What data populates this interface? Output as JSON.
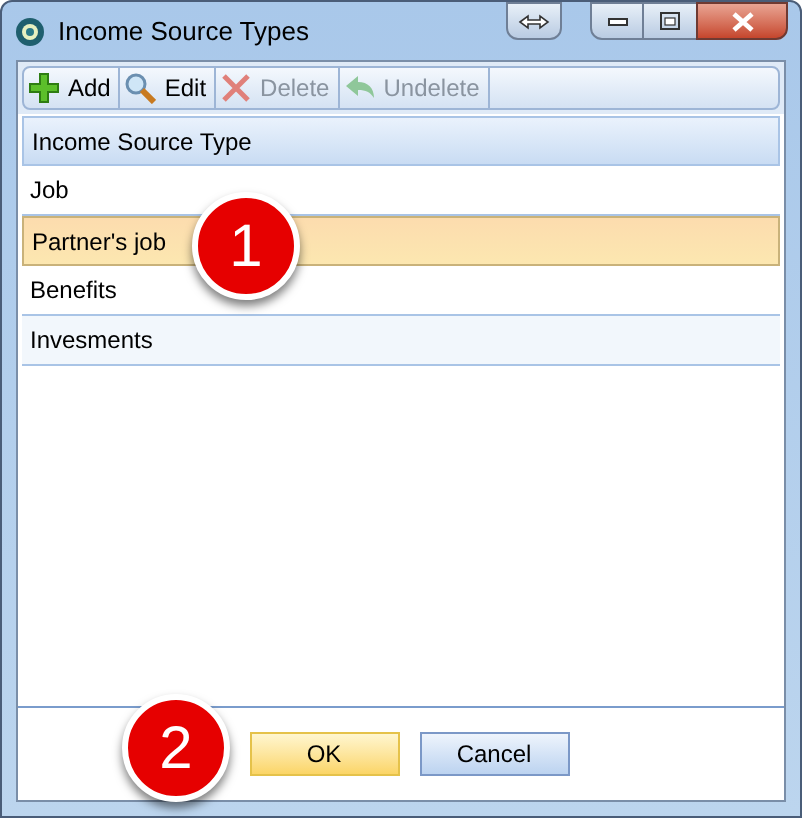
{
  "window": {
    "title": "Income Source Types"
  },
  "toolbar": [
    {
      "label": "Add",
      "kind": "add",
      "disabled": false
    },
    {
      "label": "Edit",
      "kind": "edit",
      "disabled": false
    },
    {
      "label": "Delete",
      "kind": "delete",
      "disabled": true
    },
    {
      "label": "Undelete",
      "kind": "undelete",
      "disabled": true
    }
  ],
  "table": {
    "columns": [
      "Income Source Type"
    ],
    "rows": [
      {
        "cells": [
          "Job"
        ],
        "selected": false
      },
      {
        "cells": [
          "Partner's job"
        ],
        "selected": true
      },
      {
        "cells": [
          "Benefits"
        ],
        "selected": false
      },
      {
        "cells": [
          "Invesments"
        ],
        "selected": false
      }
    ]
  },
  "buttons": [
    {
      "label": "OK",
      "default": true
    },
    {
      "label": "Cancel",
      "default": false
    }
  ],
  "callouts": [
    {
      "number": "1"
    },
    {
      "number": "2"
    }
  ]
}
